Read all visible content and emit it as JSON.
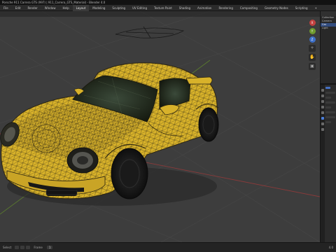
{
  "window": {
    "title": "Porsche 911 Carrera GTS (997) | 911_Carrera_GTS_Material) - Blender 4.0"
  },
  "menubar": {
    "items": [
      "File",
      "Edit",
      "Render",
      "Window",
      "Help",
      "Layout",
      "Modeling",
      "Sculpting",
      "UV Editing",
      "Texture Paint",
      "Shading",
      "Animation",
      "Rendering",
      "Compositing",
      "Geometry Nodes",
      "Scripting",
      "+"
    ]
  },
  "outliner": {
    "rows": [
      "Collection",
      "Camera",
      "Car",
      "Light"
    ]
  },
  "statusbar": {
    "frame_label": "Frame",
    "frame_value": "1",
    "tool_label": "Select",
    "version": "4.0"
  },
  "colors": {
    "viewport_bg": "#3d3d3d",
    "car_body": "#d8b22a",
    "wire": "#3a3016",
    "x_axis": "#c2413f",
    "y_axis": "#6f9b2e",
    "selected": "#334d80"
  },
  "icons": {
    "gizmo_x": "x-axis-ball",
    "gizmo_y": "y-axis-ball",
    "gizmo_z": "z-axis-ball",
    "zoom": "zoom-icon",
    "pan": "hand-icon",
    "camera": "camera-icon"
  }
}
